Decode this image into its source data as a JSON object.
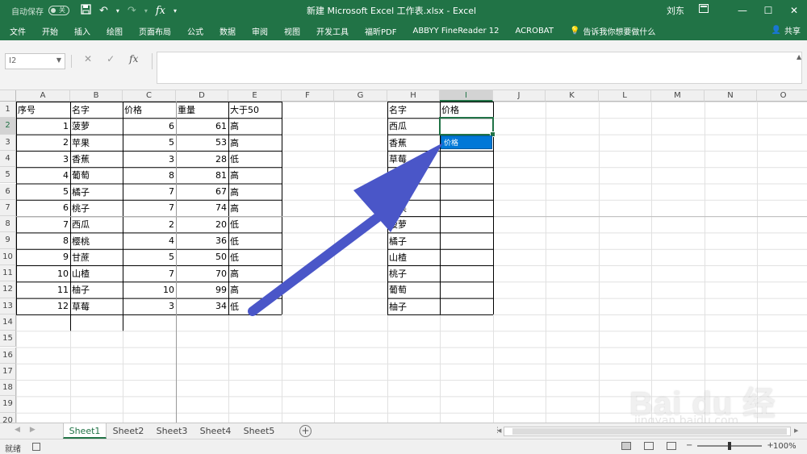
{
  "titlebar": {
    "autosave_label": "自动保存",
    "autosave_state": "关",
    "title": "新建 Microsoft Excel 工作表.xlsx  -  Excel",
    "user": "刘东"
  },
  "tabs": [
    "文件",
    "开始",
    "插入",
    "绘图",
    "页面布局",
    "公式",
    "数据",
    "审阅",
    "视图",
    "开发工具",
    "福昕PDF",
    "ABBYY FineReader 12",
    "ACROBAT"
  ],
  "tellme": "告诉我你想要做什么",
  "share": "共享",
  "namebox": "I2",
  "formula": "",
  "columns": [
    {
      "label": "A",
      "w": 67
    },
    {
      "label": "B",
      "w": 65
    },
    {
      "label": "C",
      "w": 66
    },
    {
      "label": "D",
      "w": 65
    },
    {
      "label": "E",
      "w": 66
    },
    {
      "label": "F",
      "w": 65
    },
    {
      "label": "G",
      "w": 66
    },
    {
      "label": "H",
      "w": 65
    },
    {
      "label": "I",
      "w": 66
    },
    {
      "label": "J",
      "w": 65
    },
    {
      "label": "K",
      "w": 66
    },
    {
      "label": "L",
      "w": 65
    },
    {
      "label": "M",
      "w": 66
    },
    {
      "label": "N",
      "w": 65
    },
    {
      "label": "O",
      "w": 66
    }
  ],
  "rows": [
    "1",
    "2",
    "3",
    "4",
    "5",
    "6",
    "7",
    "8",
    "9",
    "10",
    "11",
    "12",
    "13",
    "14",
    "15",
    "16",
    "17",
    "18",
    "19",
    "20"
  ],
  "table1": {
    "headers": [
      "序号",
      "名字",
      "价格",
      "重量",
      "大于50"
    ],
    "data": [
      [
        "1",
        "菠萝",
        "6",
        "61",
        "高"
      ],
      [
        "2",
        "苹果",
        "5",
        "53",
        "高"
      ],
      [
        "3",
        "香蕉",
        "3",
        "28",
        "低"
      ],
      [
        "4",
        "葡萄",
        "8",
        "81",
        "高"
      ],
      [
        "5",
        "橘子",
        "7",
        "67",
        "高"
      ],
      [
        "6",
        "桃子",
        "7",
        "74",
        "高"
      ],
      [
        "7",
        "西瓜",
        "2",
        "20",
        "低"
      ],
      [
        "8",
        "樱桃",
        "4",
        "36",
        "低"
      ],
      [
        "9",
        "甘蔗",
        "5",
        "50",
        "低"
      ],
      [
        "10",
        "山楂",
        "7",
        "70",
        "高"
      ],
      [
        "11",
        "柚子",
        "10",
        "99",
        "高"
      ],
      [
        "12",
        "草莓",
        "3",
        "34",
        "低"
      ]
    ]
  },
  "table2": {
    "headers": [
      "名字",
      "价格"
    ],
    "names": [
      "西瓜",
      "香蕉",
      "草莓",
      "樱桃",
      "甘蔗",
      "苹果",
      "菠萝",
      "橘子",
      "山楂",
      "桃子",
      "葡萄",
      "柚子"
    ]
  },
  "dv_popup": "价格",
  "sheets": [
    "Sheet1",
    "Sheet2",
    "Sheet3",
    "Sheet4",
    "Sheet5"
  ],
  "status": {
    "ready": "就绪",
    "zoom": "100%"
  },
  "watermark": {
    "main": "Bai du 经验",
    "sub": "jingyan.baidu.com"
  },
  "colors": {
    "excel_green": "#217346",
    "arrow": "#4a56c8"
  }
}
